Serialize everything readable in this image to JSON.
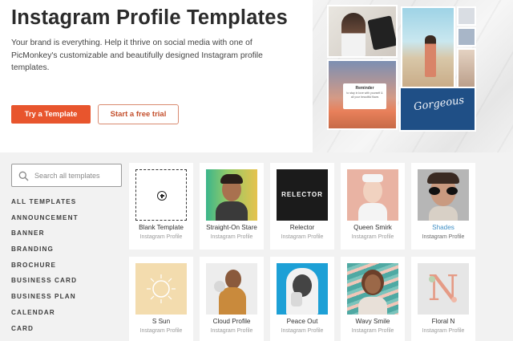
{
  "hero": {
    "title": "Instagram Profile Templates",
    "description": "Your brand is everything. Help it thrive on social media with one of PicMonkey's customizable and beautifully designed Instagram profile templates.",
    "primary_button": "Try a Template",
    "secondary_button": "Start a free trial",
    "collage": {
      "reminder_title": "Reminder",
      "reminder_text": "to stay in love with yourself & all your beautiful flaws",
      "script_text": "Gorgeous"
    }
  },
  "search": {
    "placeholder": "Search all templates",
    "value": ""
  },
  "categories": [
    "ALL TEMPLATES",
    "ANNOUNCEMENT",
    "BANNER",
    "BRANDING",
    "BROCHURE",
    "BUSINESS CARD",
    "BUSINESS PLAN",
    "CALENDAR",
    "CARD"
  ],
  "templates": [
    {
      "name": "Blank Template",
      "type": "Instagram Profile",
      "icon": "plus-circle-icon"
    },
    {
      "name": "Straight-On Stare",
      "type": "Instagram Profile"
    },
    {
      "name": "Relector",
      "type": "Instagram Profile",
      "thumb_text": "RELECTOR"
    },
    {
      "name": "Queen Smirk",
      "type": "Instagram Profile"
    },
    {
      "name": "Shades",
      "type": "Instagram Profile",
      "highlighted": true
    },
    {
      "name": "S Sun",
      "type": "Instagram Profile"
    },
    {
      "name": "Cloud Profile",
      "type": "Instagram Profile"
    },
    {
      "name": "Peace Out",
      "type": "Instagram Profile"
    },
    {
      "name": "Wavy Smile",
      "type": "Instagram Profile"
    },
    {
      "name": "Floral N",
      "type": "Instagram Profile",
      "thumb_text": "N"
    }
  ],
  "colors": {
    "accent": "#e8552d",
    "link": "#3f8fc5",
    "panel_bg": "#f2f2f2"
  }
}
